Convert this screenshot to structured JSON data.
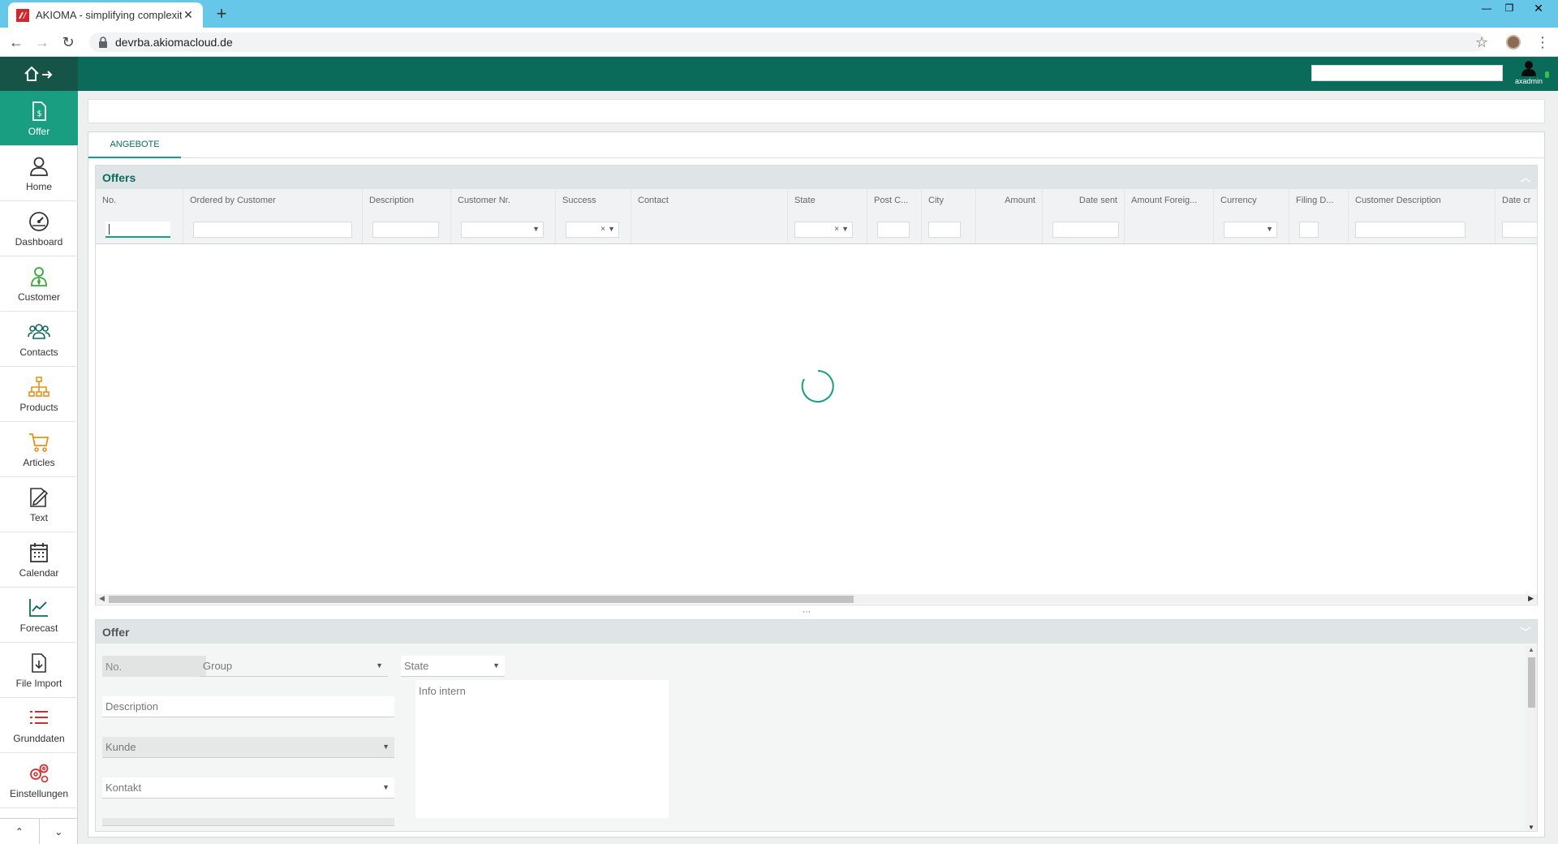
{
  "browser": {
    "tab_title": "AKIOMA - simplifying complexity",
    "tab_close": "✕",
    "new_tab": "+",
    "url": "devrba.akiomacloud.de",
    "window_controls": {
      "minimize": "—",
      "restore": "❐",
      "close": "✕"
    }
  },
  "header": {
    "user_name": "axadmin",
    "search_value": ""
  },
  "sidebar": {
    "items": [
      {
        "label": "Offer",
        "icon": "offer-icon",
        "color": "#ffffff"
      },
      {
        "label": "Home",
        "icon": "home-icon",
        "color": "#333333"
      },
      {
        "label": "Dashboard",
        "icon": "dashboard-icon",
        "color": "#333333"
      },
      {
        "label": "Customer",
        "icon": "customer-icon",
        "color": "#3aa83a"
      },
      {
        "label": "Contacts",
        "icon": "contacts-icon",
        "color": "#0b6b5a"
      },
      {
        "label": "Products",
        "icon": "products-icon",
        "color": "#e6911a"
      },
      {
        "label": "Articles",
        "icon": "cart-icon",
        "color": "#e6911a"
      },
      {
        "label": "Text",
        "icon": "text-edit-icon",
        "color": "#333333"
      },
      {
        "label": "Calendar",
        "icon": "calendar-icon",
        "color": "#333333"
      },
      {
        "label": "Forecast",
        "icon": "chart-line-icon",
        "color": "#0b6b5a"
      },
      {
        "label": "File Import",
        "icon": "file-import-icon",
        "color": "#333333"
      },
      {
        "label": "Grunddaten",
        "icon": "list-icon",
        "color": "#d62b2b"
      },
      {
        "label": "Einstellungen",
        "icon": "gears-icon",
        "color": "#d62b2b"
      }
    ],
    "scroll_up": "⌃",
    "scroll_down": "⌄"
  },
  "main": {
    "tab_label": "ANGEBOTE",
    "grid": {
      "title": "Offers",
      "columns": [
        "No.",
        "Ordered by Customer",
        "Description",
        "Customer Nr.",
        "Success",
        "Contact",
        "State",
        "Post C...",
        "City",
        "Amount",
        "Date sent",
        "Amount Foreig...",
        "Currency",
        "Filing D...",
        "Customer Description",
        "Date cr"
      ],
      "loading": true
    },
    "form": {
      "title": "Offer",
      "fields": {
        "no": "No.",
        "group": "Group",
        "state": "State",
        "description": "Description",
        "info_intern": "Info intern",
        "kunde": "Kunde",
        "kontakt": "Kontakt"
      }
    }
  },
  "colors": {
    "brand_dark": "#0b6b5a",
    "brand_accent": "#1a9e82",
    "browser_bar": "#67c7e8"
  }
}
